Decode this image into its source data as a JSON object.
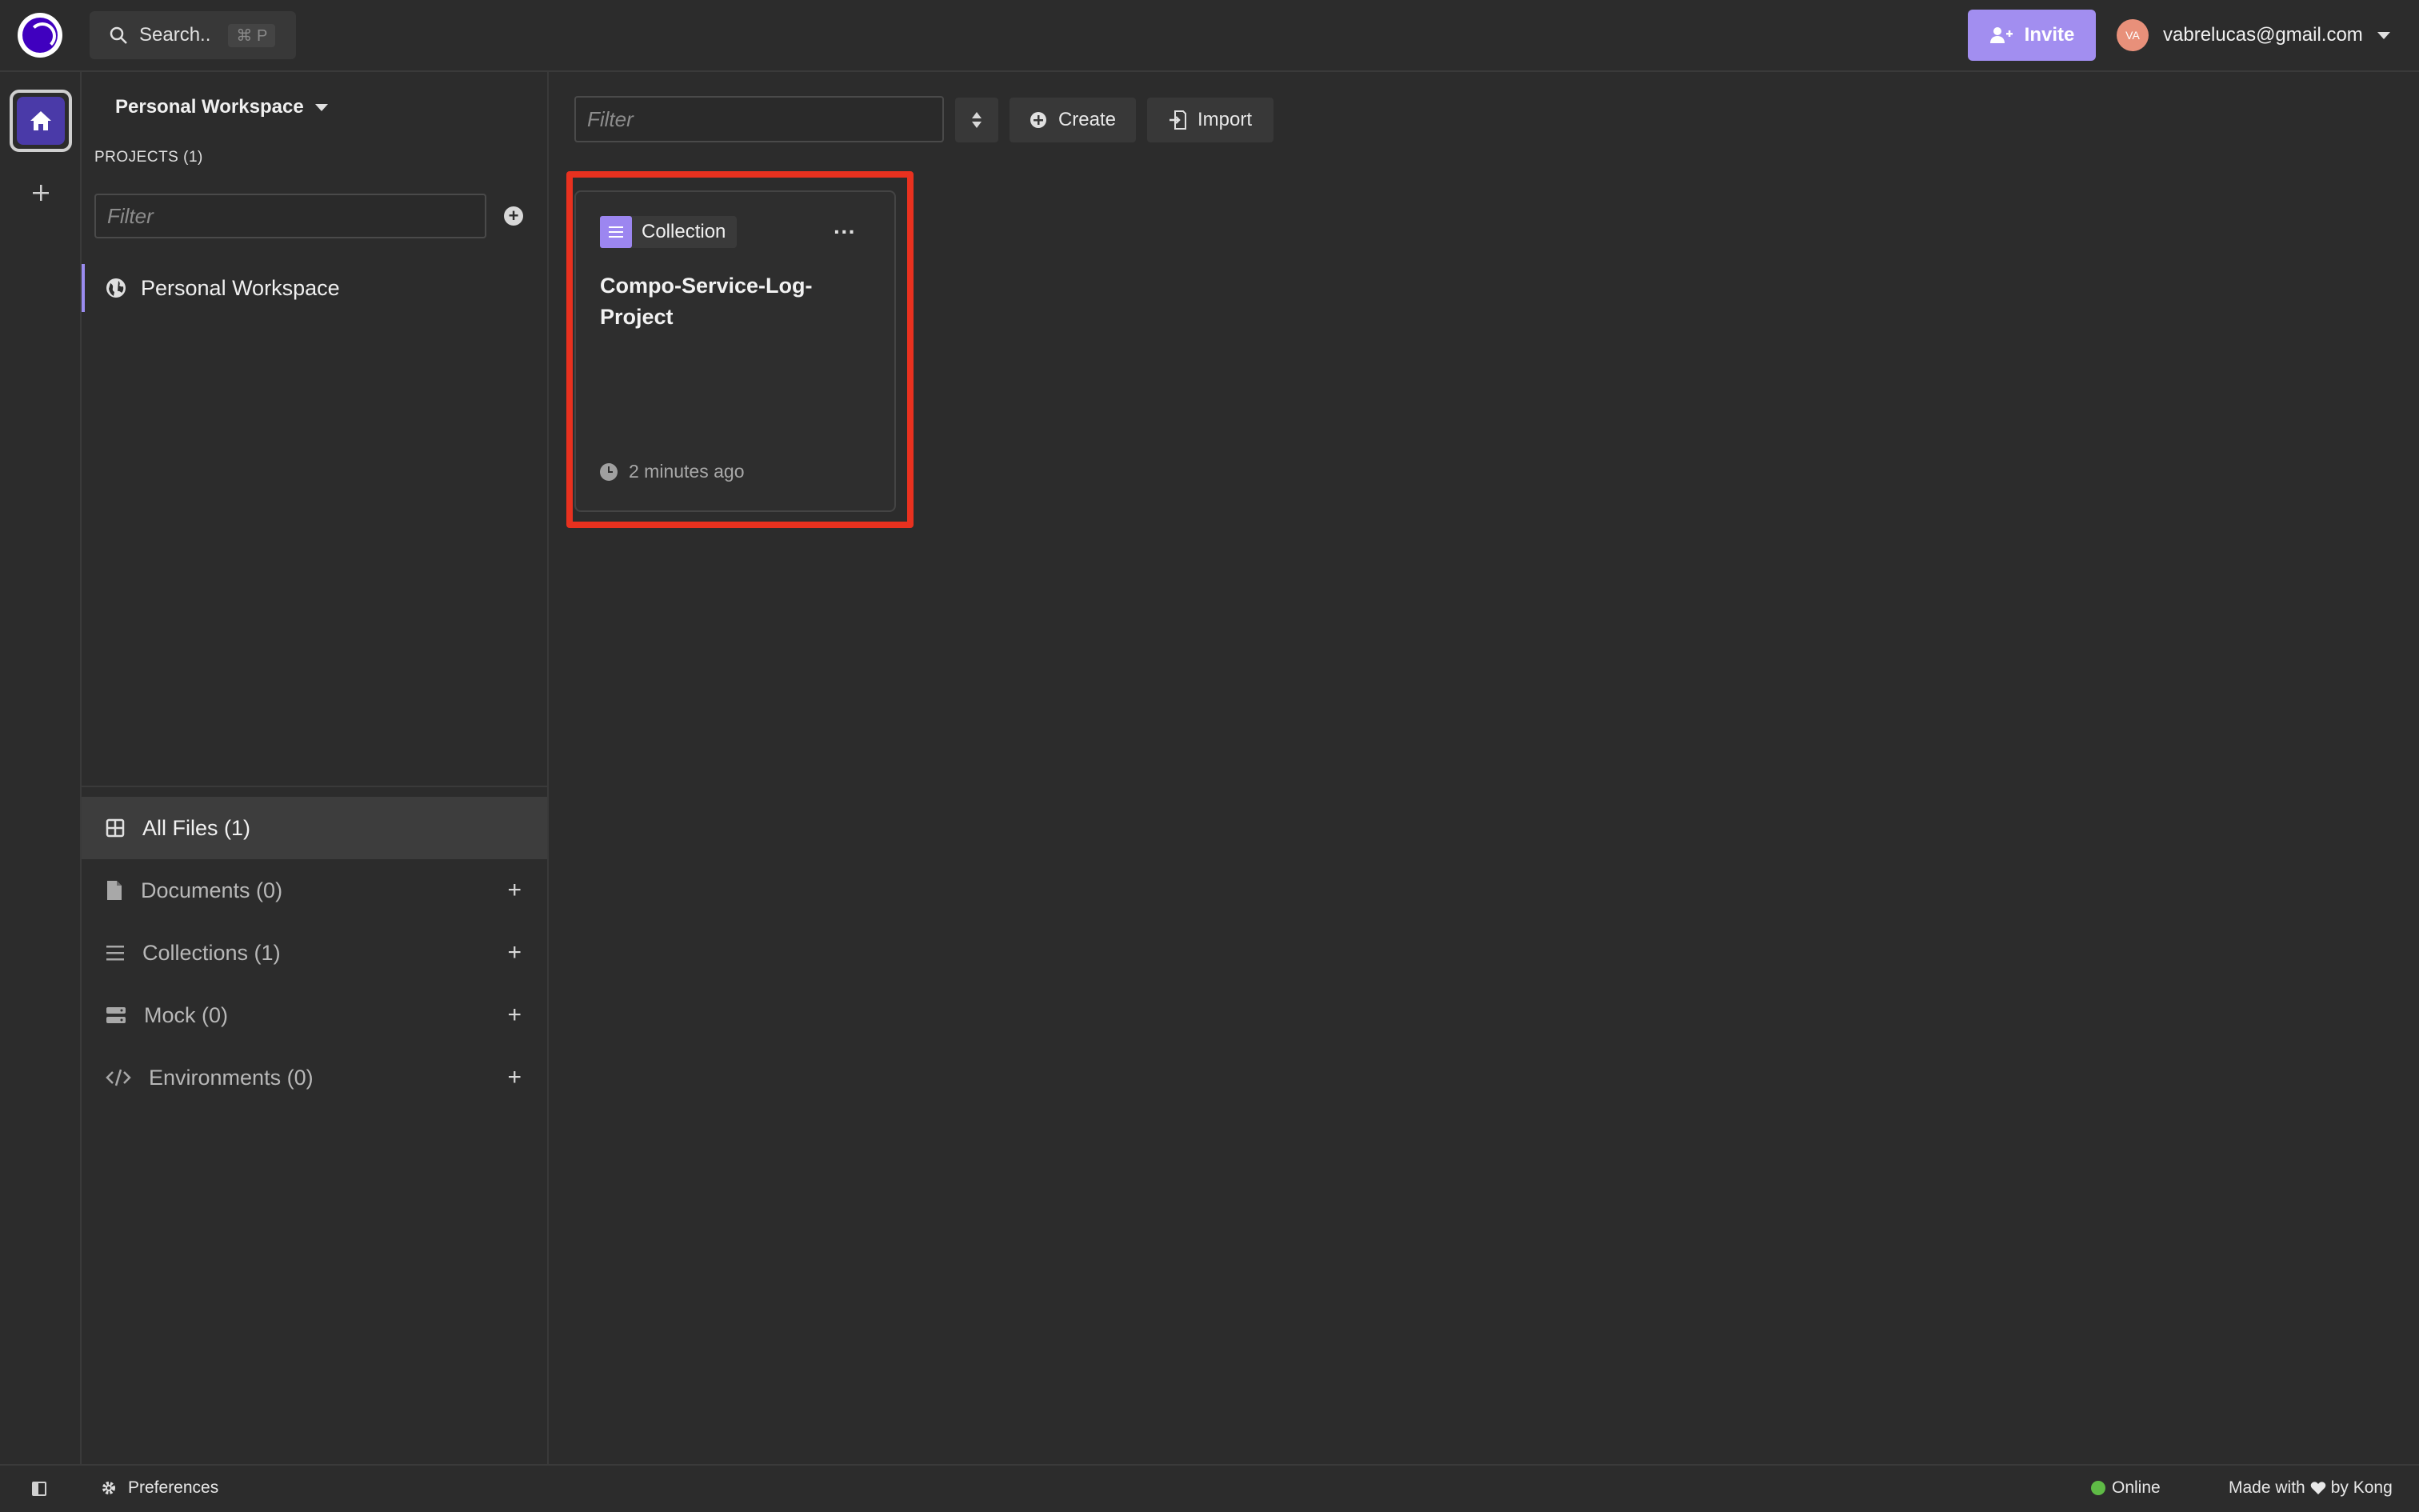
{
  "topbar": {
    "search_label": "Search..",
    "search_shortcut": "⌘ P",
    "invite_label": "Invite",
    "user_initials": "VA",
    "user_email": "vabrelucas@gmail.com"
  },
  "sidebar": {
    "workspace_title": "Personal Workspace",
    "projects_label": "PROJECTS (1)",
    "filter_placeholder": "Filter",
    "project_name": "Personal Workspace",
    "nav": [
      {
        "label": "All Files (1)",
        "icon": "grid-icon"
      },
      {
        "label": "Documents (0)",
        "icon": "document-icon"
      },
      {
        "label": "Collections (1)",
        "icon": "list-icon"
      },
      {
        "label": "Mock (0)",
        "icon": "server-icon"
      },
      {
        "label": "Environments (0)",
        "icon": "code-icon"
      }
    ]
  },
  "main": {
    "filter_placeholder": "Filter",
    "create_label": "Create",
    "import_label": "Import",
    "card": {
      "type_label": "Collection",
      "title": "Compo-Service-Log-Project",
      "time": "2 minutes ago"
    }
  },
  "statusbar": {
    "preferences_label": "Preferences",
    "online_label": "Online",
    "made_with_prefix": "Made with",
    "made_with_suffix": "by Kong"
  },
  "colors": {
    "background": "#2c2c2c",
    "accent": "#a28ef0",
    "highlight": "#e8311f",
    "online": "#5fbb46"
  }
}
